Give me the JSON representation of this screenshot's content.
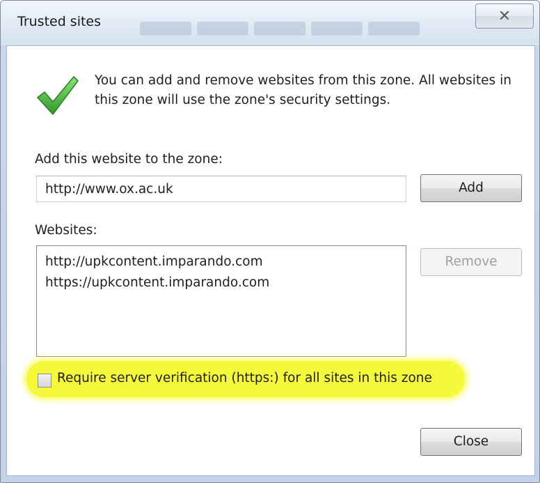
{
  "window": {
    "title": "Trusted sites",
    "close_glyph": "✕"
  },
  "info": {
    "text": "You can add and remove websites from this zone. All websites in this zone will use the zone's security settings."
  },
  "add_section": {
    "label": "Add this website to the zone:",
    "input_value": "http://www.ox.ac.uk",
    "add_button": "Add"
  },
  "websites": {
    "label": "Websites:",
    "items": [
      "http://upkcontent.imparando.com",
      "https://upkcontent.imparando.com"
    ],
    "remove_button": "Remove"
  },
  "verification": {
    "label": "Require server verification (https:) for all sites in this zone",
    "checked": false,
    "highlight_color": "#f6f93a"
  },
  "footer": {
    "close_button": "Close"
  },
  "icons": {
    "zone": "checkmark-icon",
    "close": "close-icon"
  }
}
